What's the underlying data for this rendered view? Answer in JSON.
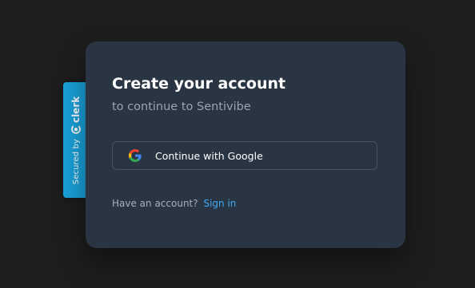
{
  "badge": {
    "secured_by": "Secured by",
    "brand": "clerk",
    "color": "#1aa3dc"
  },
  "card": {
    "title": "Create your account",
    "subtitle": "to continue to Sentivibe",
    "google_button": {
      "label": "Continue with Google",
      "icon": "google-icon"
    },
    "footer": {
      "prompt": "Have an account?",
      "link": "Sign in",
      "link_color": "#3fa9f5"
    },
    "background": "#2a3544"
  },
  "page": {
    "background": "#1e1e1e"
  }
}
